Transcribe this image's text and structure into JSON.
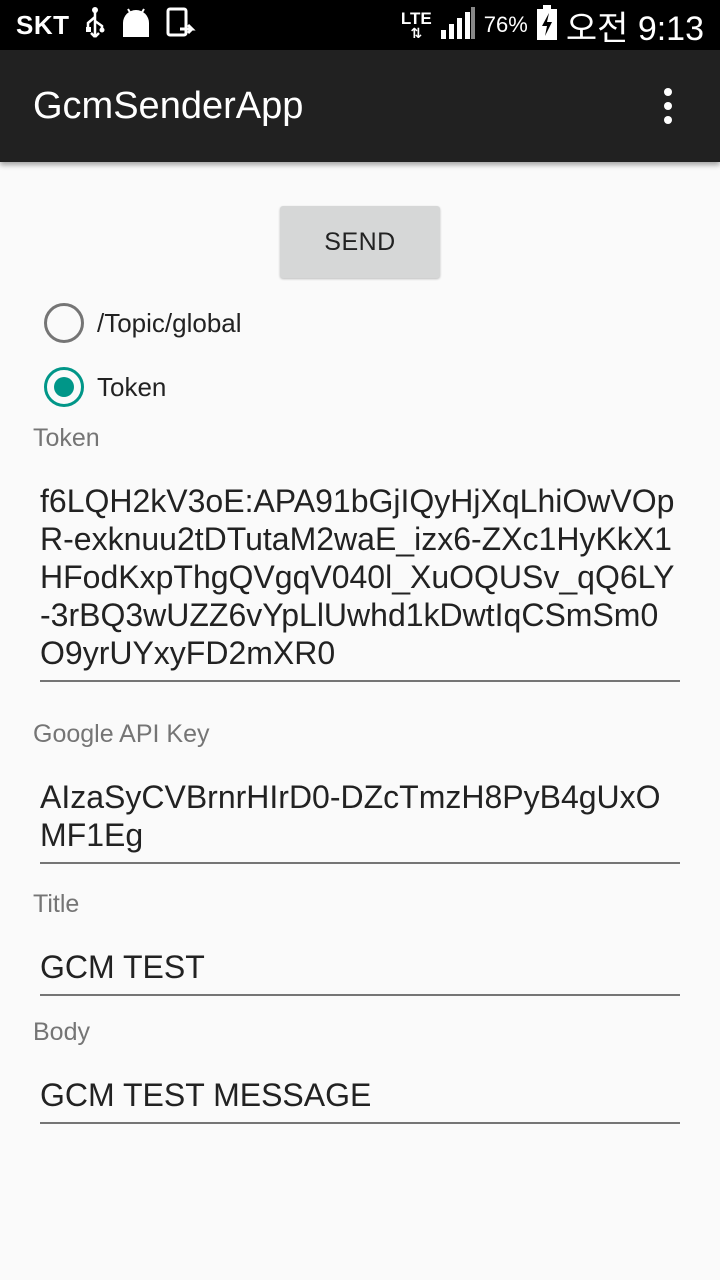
{
  "status_bar": {
    "carrier": "SKT",
    "network": "LTE",
    "battery_percent": "76%",
    "time": "오전 9:13",
    "icons": [
      "usb-icon",
      "android-icon",
      "screenshot-icon",
      "signal-icon",
      "battery-charging-icon"
    ]
  },
  "app_bar": {
    "title": "GcmSenderApp",
    "overflow_icon": "more-vert-icon"
  },
  "send_button": {
    "label": "SEND"
  },
  "target_radio": {
    "options": [
      {
        "label": "/Topic/global",
        "checked": false
      },
      {
        "label": "Token",
        "checked": true
      }
    ]
  },
  "fields": {
    "token": {
      "label": "Token",
      "value": "f6LQH2kV3oE:APA91bGjIQyHjXqLhiOwVOpR-exknuu2tDTutaM2waE_izx6-ZXc1HyKkX1HFodKxpThgQVgqV040l_XuOQUSv_qQ6LY-3rBQ3wUZZ6vYpLlUwhd1kDwtIqCSmSm0O9yrUYxyFD2mXR0"
    },
    "api_key": {
      "label": "Google API Key",
      "value": "AIzaSyCVBrnrHIrD0-DZcTmzH8PyB4gUxOMF1Eg"
    },
    "title": {
      "label": "Title",
      "value": "GCM TEST"
    },
    "body": {
      "label": "Body",
      "value": "GCM TEST MESSAGE"
    }
  },
  "colors": {
    "accent": "#009688",
    "app_bar": "#212121",
    "background": "#fafafa"
  }
}
